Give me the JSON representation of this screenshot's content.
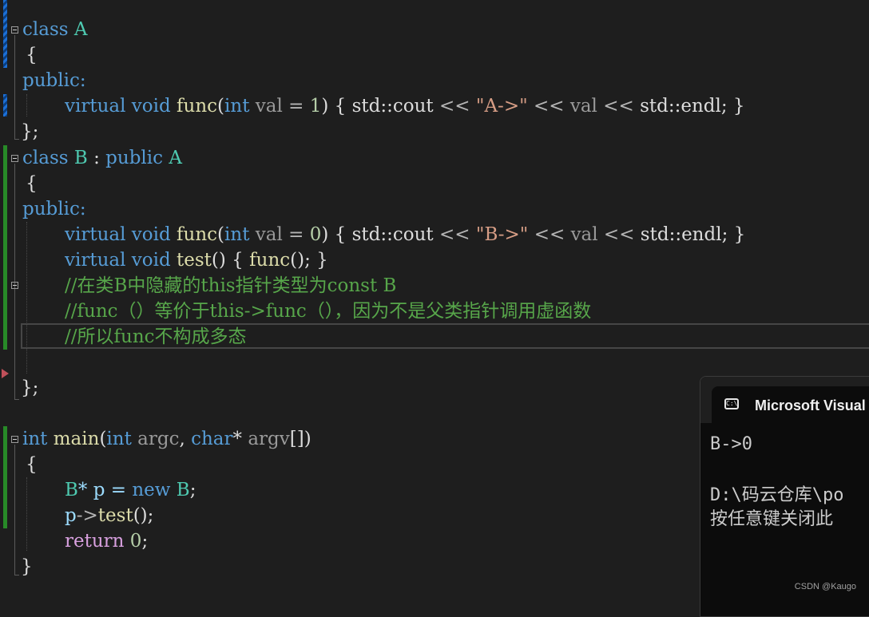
{
  "code": {
    "class_kw": "class",
    "class_a_name": "A",
    "brace_open": "{",
    "public_label": "public:",
    "virtual_kw": "virtual",
    "void_kw": "void",
    "func_name": "func",
    "paren_open": "(",
    "int_kw": "int",
    "val_param": "val",
    "eq": " = ",
    "default_a": "1",
    "paren_close": ")",
    "body_open": " { ",
    "std_cout": "std::cout",
    "shift_op": " << ",
    "str_a": "\"A->\"",
    "val_ref": "val",
    "std_endl": "std::endl",
    "body_close": "; }",
    "class_close": "};",
    "class_b_name": "B",
    "colon": " : ",
    "public_kw": "public",
    "base_a": "A",
    "default_b": "0",
    "str_b": "\"B->\"",
    "test_name": "test",
    "test_body_open": "() { ",
    "func_call": "func",
    "test_body_close": "(); }",
    "comment_1": "//在类B中隐藏的this指针类型为const B",
    "comment_2": "//func（）等价于this->func（），因为不是父类指针调用虚函数",
    "comment_3": "//所以func不构成多态",
    "main_name": "main",
    "argc_param": "argc",
    "char_kw": "char",
    "argv_param": "argv",
    "main_sig_tail": "[])",
    "new_line_type": "B",
    "ptr_p": "* p = ",
    "new_kw": "new",
    "new_type": "B",
    "semi": ";",
    "p_var": "p",
    "arrow": "->",
    "test_call_tail": "();",
    "return_kw": "return",
    "return_val": "0",
    "brace_close": "}"
  },
  "console": {
    "title": "Microsoft Visual S",
    "icon_text": "C:\\",
    "output_1": "B->0",
    "output_2": "D:\\码云仓库\\po",
    "output_3": "按任意键关闭此"
  },
  "watermark": "CSDN @Kaugo"
}
